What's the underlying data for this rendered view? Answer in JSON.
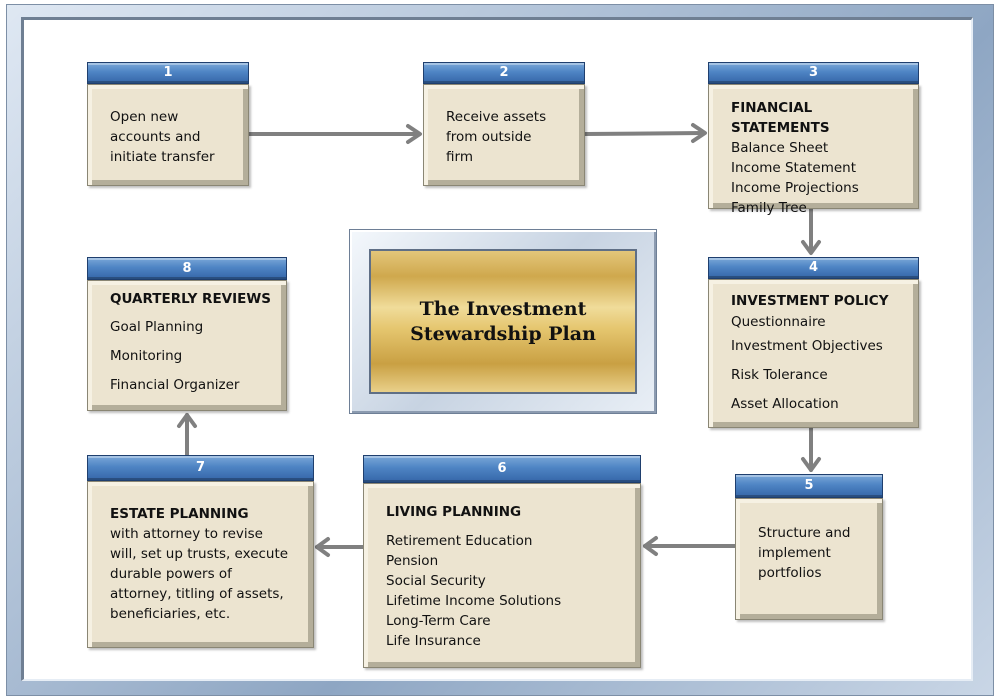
{
  "title": "The Investment Stewardship Plan",
  "title_lines": [
    "The Investment",
    "Stewardship Plan"
  ],
  "colors": {
    "header_blue": "#4e84c4",
    "body_beige": "#ece4d0",
    "arrow_gray": "#808080",
    "plaque_gold": "#d9b860"
  },
  "steps": [
    {
      "number": "1",
      "title": "",
      "lines": [
        "Open new",
        "accounts and",
        "initiate transfer"
      ]
    },
    {
      "number": "2",
      "title": "",
      "lines": [
        "Receive assets",
        "from outside",
        "firm"
      ]
    },
    {
      "number": "3",
      "title": "FINANCIAL STATEMENTS",
      "lines": [
        "Balance Sheet",
        "Income Statement",
        "Income Projections",
        "Family Tree"
      ]
    },
    {
      "number": "4",
      "title": "INVESTMENT POLICY",
      "lines": [
        "Questionnaire",
        "Investment Objectives",
        "Risk Tolerance",
        "Asset Allocation"
      ]
    },
    {
      "number": "5",
      "title": "",
      "lines": [
        "Structure and",
        "implement",
        "portfolios"
      ]
    },
    {
      "number": "6",
      "title": "LIVING PLANNING",
      "lines": [
        "Retirement Education",
        "Pension",
        "Social Security",
        "Lifetime Income Solutions",
        "Long-Term Care",
        "Life Insurance"
      ]
    },
    {
      "number": "7",
      "title": "ESTATE PLANNING",
      "lines": [
        "with attorney  to revise",
        "will, set up trusts, execute",
        "durable powers of",
        "attorney, titling of assets,",
        "beneficiaries, etc."
      ]
    },
    {
      "number": "8",
      "title": "QUARTERLY REVIEWS",
      "lines": [
        "Goal Planning",
        "Monitoring",
        "Financial Organizer"
      ]
    }
  ],
  "flow": [
    [
      "1",
      "2"
    ],
    [
      "2",
      "3"
    ],
    [
      "3",
      "4"
    ],
    [
      "4",
      "5"
    ],
    [
      "5",
      "6"
    ],
    [
      "6",
      "7"
    ],
    [
      "7",
      "8"
    ]
  ]
}
